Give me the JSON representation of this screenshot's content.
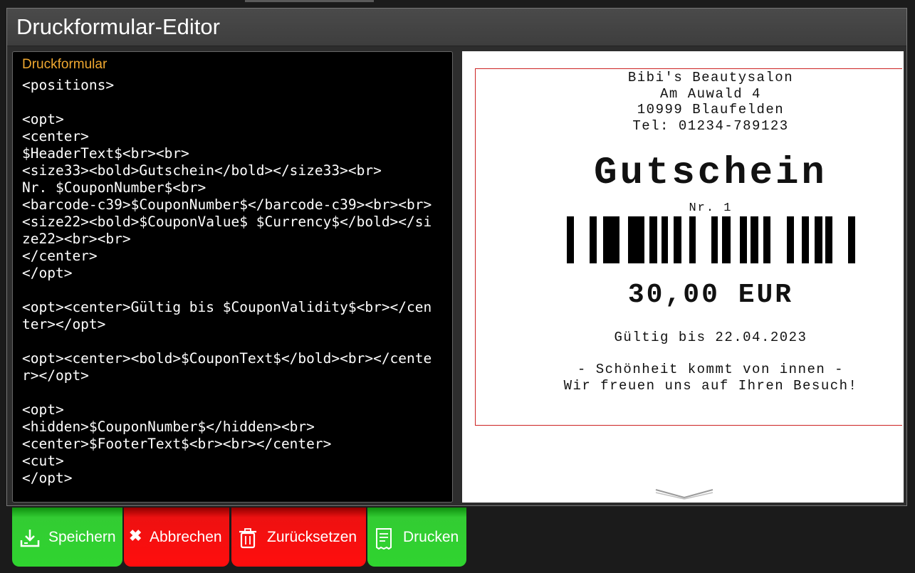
{
  "window": {
    "title": "Druckformular-Editor"
  },
  "editor": {
    "label": "Druckformular",
    "content": "<positions>\n\n<opt>\n<center>\n$HeaderText$<br><br>\n<size33><bold>Gutschein</bold></size33><br>\nNr. $CouponNumber$<br>\n<barcode-c39>$CouponNumber$</barcode-c39><br><br>\n<size22><bold>$CouponValue$ $Currency$</bold></size22><br><br>\n</center>\n</opt>\n\n<opt><center>Gültig bis $CouponValidity$<br></center></opt>\n\n<opt><center><bold>$CouponText$</bold><br></center></opt>\n\n<opt>\n<hidden>$CouponNumber$</hidden><br>\n<center>$FooterText$<br><br></center>\n<cut>\n</opt>"
  },
  "preview": {
    "header_lines": [
      "Bibi's Beautysalon",
      "Am Auwald 4",
      "10999 Blaufelden",
      "Tel: 01234-789123"
    ],
    "coupon_title": "Gutschein",
    "coupon_number": "Nr. 1",
    "coupon_value": "30,00 EUR",
    "validity": "Gültig bis 22.04.2023",
    "text_line1": "- Schönheit kommt von innen -",
    "text_line2": "Wir freuen uns auf Ihren Besuch!"
  },
  "buttons": {
    "save": "Speichern",
    "cancel": "Abbrechen",
    "reset": "Zurücksetzen",
    "print": "Drucken"
  },
  "icons": {
    "save": "download-icon",
    "cancel": "close-icon",
    "reset": "trash-icon",
    "print": "receipt-icon",
    "scroll": "chevron-down-icon"
  },
  "colors": {
    "accent_label": "#f0a830",
    "button_green": "#33cc33",
    "button_red": "#ee1111",
    "receipt_border": "#cc2222"
  }
}
